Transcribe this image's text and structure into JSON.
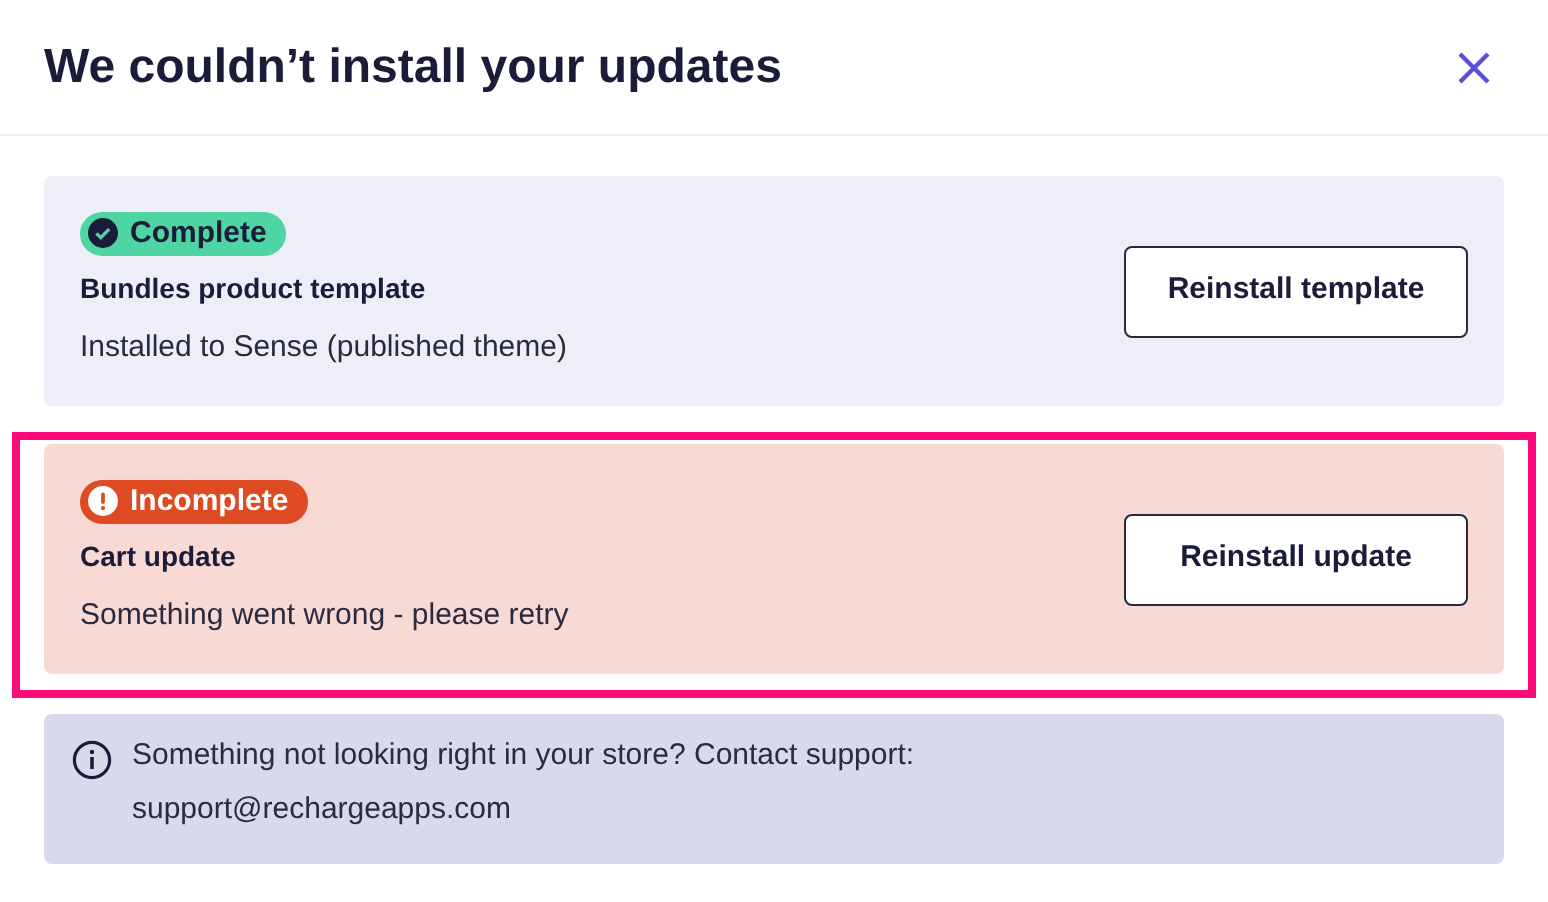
{
  "dialog": {
    "title": "We couldn’t install your updates"
  },
  "items": [
    {
      "kind": "complete",
      "badge": "Complete",
      "title": "Bundles product template",
      "description": "Installed to Sense (published theme)",
      "button": "Reinstall template",
      "highlighted": false
    },
    {
      "kind": "incomplete",
      "badge": "Incomplete",
      "title": "Cart update",
      "description": "Something went wrong - please retry",
      "button": "Reinstall update",
      "highlighted": true
    }
  ],
  "notice": {
    "lines": [
      "Something not looking right in your store? Contact support:",
      "support@rechargeapps.com"
    ]
  }
}
